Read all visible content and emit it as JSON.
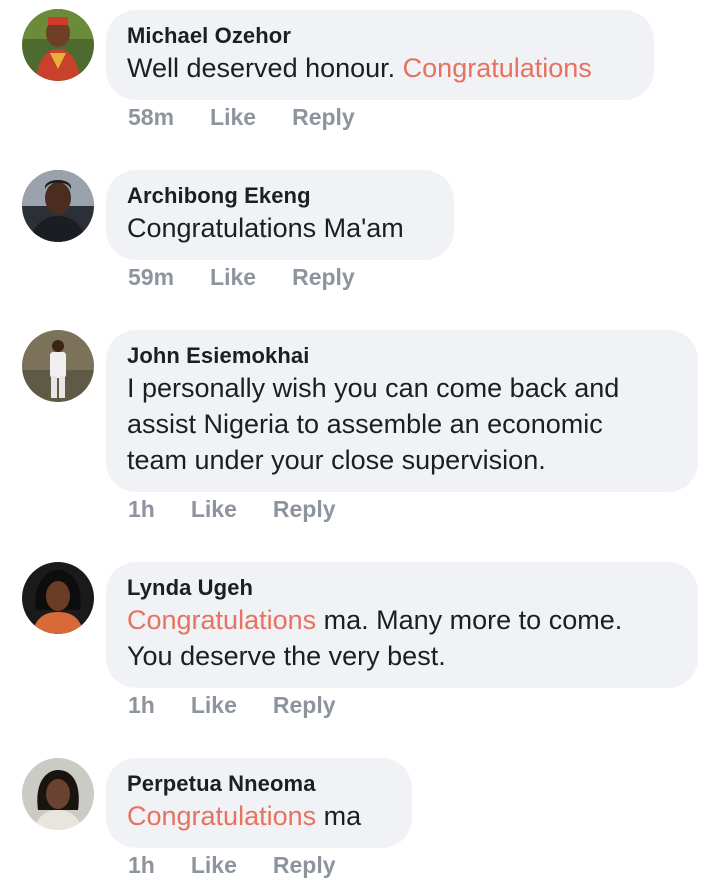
{
  "comments": [
    {
      "author": "Michael Ozehor",
      "text_before": "Well deserved honour. ",
      "highlight": "Congratulations",
      "text_after": "",
      "time": "58m",
      "like": "Like",
      "reply": "Reply"
    },
    {
      "author": "Archibong Ekeng",
      "text_before": "Congratulations Ma'am",
      "highlight": "",
      "text_after": "",
      "time": "59m",
      "like": "Like",
      "reply": "Reply"
    },
    {
      "author": "John Esiemokhai",
      "text_line1": "I personally wish you can come back and",
      "text_line2": "assist Nigeria to assemble an economic",
      "text_line3": "team under your close supervision.",
      "time": "1h",
      "like": "Like",
      "reply": "Reply"
    },
    {
      "author": "Lynda Ugeh",
      "highlight": "Congratulations",
      "text_after": " ma. Many more to come.",
      "text_line2": "You deserve the very best.",
      "time": "1h",
      "like": "Like",
      "reply": "Reply"
    },
    {
      "author": "Perpetua Nneoma",
      "highlight": "Congratulations",
      "text_after": " ma",
      "time": "1h",
      "like": "Like",
      "reply": "Reply"
    }
  ],
  "colors": {
    "highlight": "#e8715f",
    "bubble": "#f0f2f5",
    "meta": "#8d949e"
  }
}
